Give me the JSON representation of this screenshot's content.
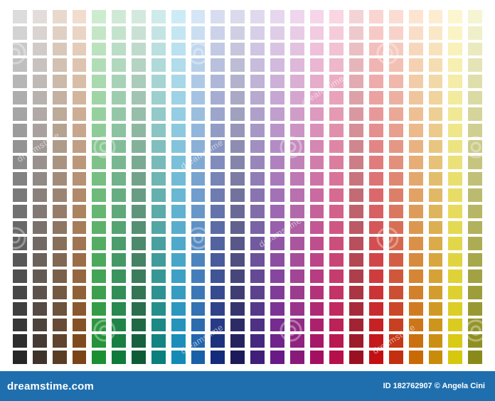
{
  "palette": {
    "columns": 24,
    "rows": 22,
    "hues": [
      {
        "name": "gray",
        "top": "#dcdcdc",
        "bottom": "#262626"
      },
      {
        "name": "warm-gray",
        "top": "#e2dddb",
        "bottom": "#3f332c"
      },
      {
        "name": "tan",
        "top": "#e8d9cc",
        "bottom": "#5a3d25"
      },
      {
        "name": "brown",
        "top": "#f1dccd",
        "bottom": "#7a4416"
      },
      {
        "name": "light-green",
        "top": "#cdeccf",
        "bottom": "#1c8f32"
      },
      {
        "name": "green",
        "top": "#cfe9d6",
        "bottom": "#0f7a3a"
      },
      {
        "name": "forest",
        "top": "#d3e9dd",
        "bottom": "#0e5c36"
      },
      {
        "name": "teal",
        "top": "#cfeaea",
        "bottom": "#0a7f7c"
      },
      {
        "name": "cyan",
        "top": "#cdebf6",
        "bottom": "#148ab6"
      },
      {
        "name": "sky",
        "top": "#d4e5f6",
        "bottom": "#1a60a8"
      },
      {
        "name": "blue",
        "top": "#d7dcf0",
        "bottom": "#142a7a"
      },
      {
        "name": "navy",
        "top": "#dadaec",
        "bottom": "#1c1a58"
      },
      {
        "name": "indigo",
        "top": "#e0d9ee",
        "bottom": "#3f1f7a"
      },
      {
        "name": "violet",
        "top": "#e6d7ee",
        "bottom": "#6a1a86"
      },
      {
        "name": "purple",
        "top": "#eed6ec",
        "bottom": "#8a1a7a"
      },
      {
        "name": "magenta",
        "top": "#f7d5e8",
        "bottom": "#a40f62"
      },
      {
        "name": "pink",
        "top": "#f9d6e2",
        "bottom": "#b6104a"
      },
      {
        "name": "rose",
        "top": "#f4d3d6",
        "bottom": "#9a1222"
      },
      {
        "name": "red",
        "top": "#f9d4d1",
        "bottom": "#c10f14"
      },
      {
        "name": "coral",
        "top": "#fbdcd3",
        "bottom": "#c2300f"
      },
      {
        "name": "orange",
        "top": "#fde4d1",
        "bottom": "#c96a06"
      },
      {
        "name": "amber",
        "top": "#fdecd0",
        "bottom": "#c98c0a"
      },
      {
        "name": "yellow",
        "top": "#fcf6cf",
        "bottom": "#d6c80c"
      },
      {
        "name": "olive",
        "top": "#f5f5d3",
        "bottom": "#8a8a1a"
      }
    ]
  },
  "watermark": {
    "text": "dreamstime"
  },
  "footer": {
    "brand": "dreamstime.com",
    "credit": "ID 182762907 © Angela Cini",
    "background": "#1f6fae"
  }
}
